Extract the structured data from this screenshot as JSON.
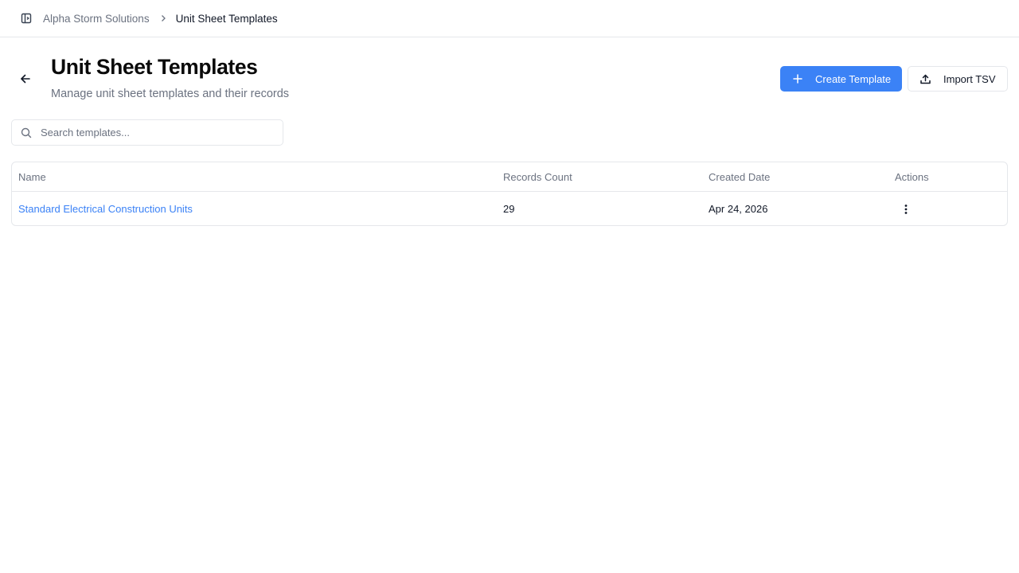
{
  "breadcrumb": {
    "org": "Alpha Storm Solutions",
    "current": "Unit Sheet Templates"
  },
  "header": {
    "title": "Unit Sheet Templates",
    "subtitle": "Manage unit sheet templates and their records",
    "create_label": "Create Template",
    "import_label": "Import TSV"
  },
  "search": {
    "placeholder": "Search templates...",
    "value": ""
  },
  "table": {
    "columns": [
      "Name",
      "Records Count",
      "Created Date",
      "Actions"
    ],
    "rows": [
      {
        "name": "Standard Electrical Construction Units",
        "records": "29",
        "created": "Apr 24, 2026"
      }
    ]
  },
  "icons": {
    "sidebar_toggle": "sidebar-toggle-icon",
    "chevron": "chevron-right-icon",
    "back": "arrow-left-icon",
    "plus": "plus-icon",
    "upload": "upload-icon",
    "search": "search-icon",
    "more": "more-vertical-icon"
  },
  "colors": {
    "accent": "#3b82f6",
    "border": "#e5e7eb",
    "muted": "#6b7280"
  }
}
